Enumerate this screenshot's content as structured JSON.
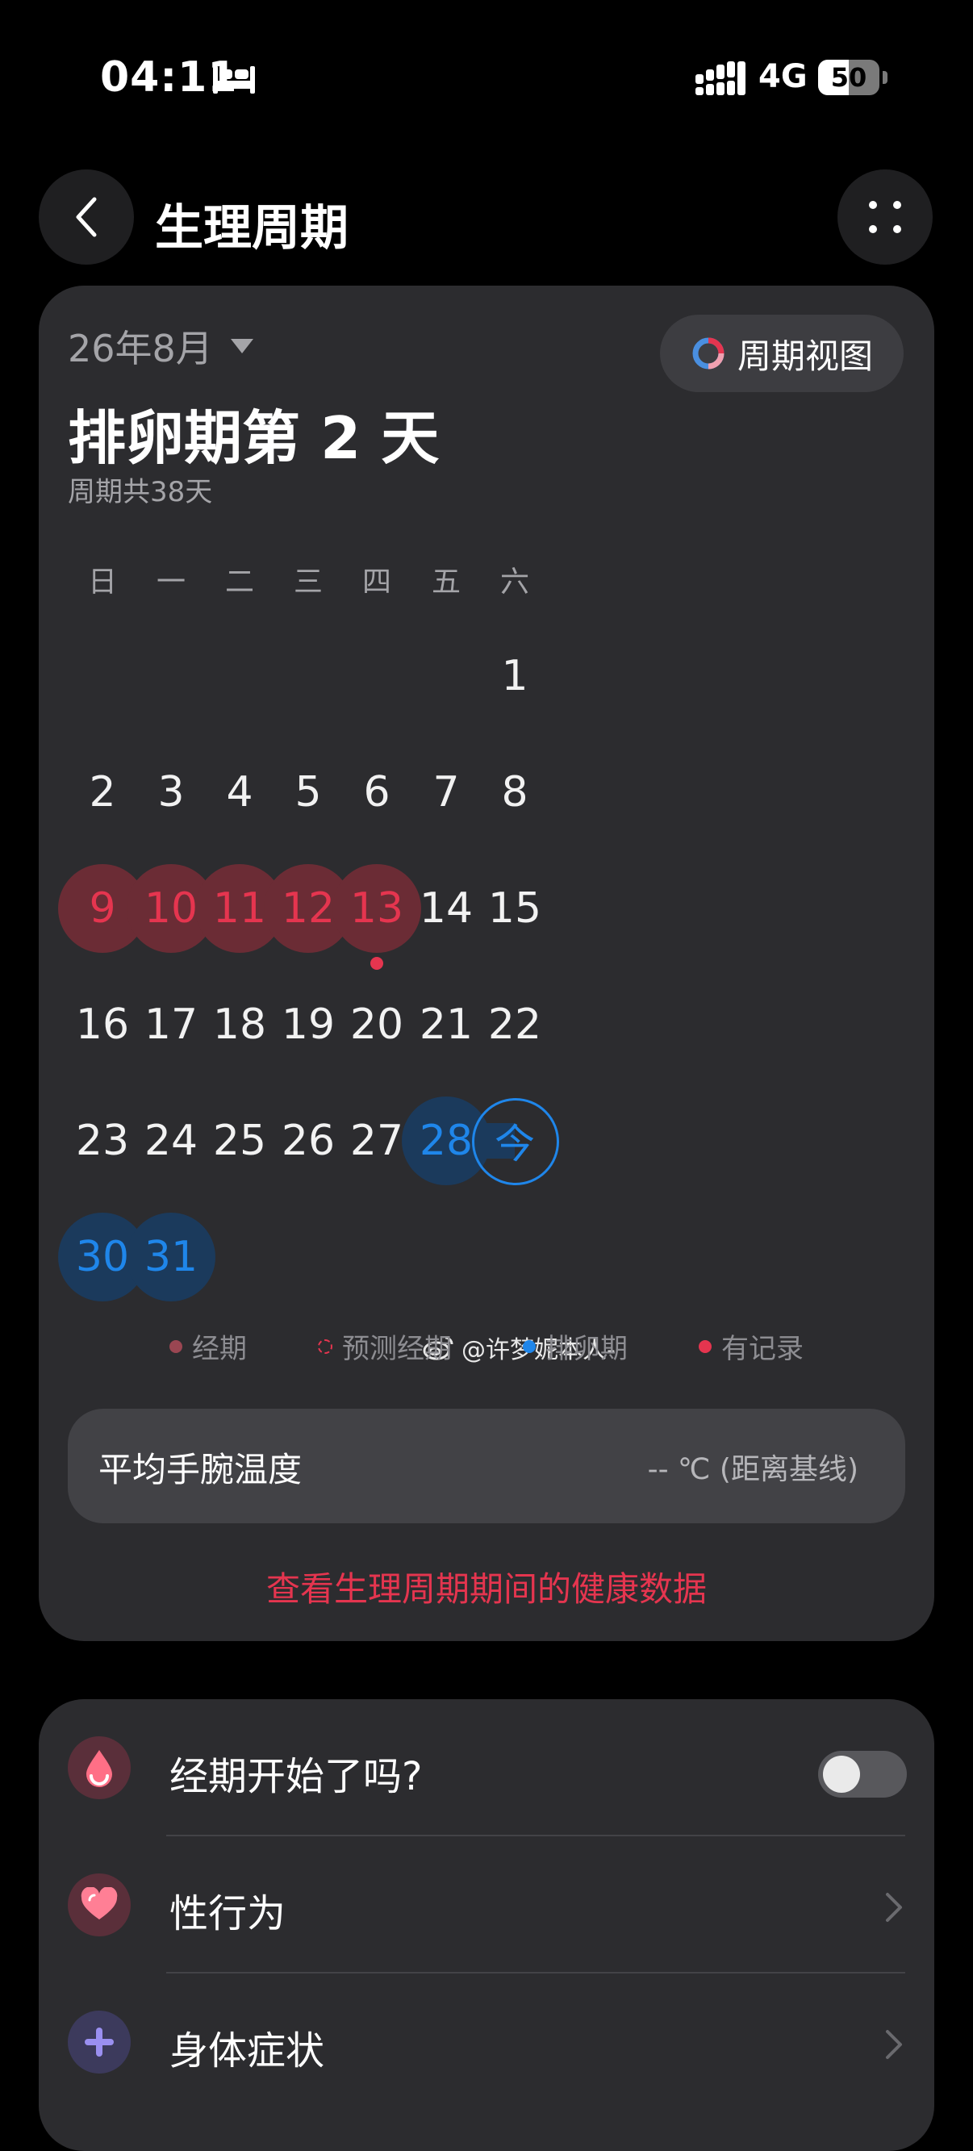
{
  "status_bar": {
    "time": "04:11",
    "network": "4G",
    "battery": "50",
    "battery_level_percent": 50
  },
  "header": {
    "title": "生理周期"
  },
  "calendar_card": {
    "month": "26年8月",
    "cycle_view_label": "周期视图",
    "phase_title": "排卵期第 2 天",
    "cycle_length": "周期共38天",
    "weekdays": [
      "日",
      "一",
      "二",
      "三",
      "四",
      "五",
      "六"
    ],
    "first_weekday_index": 6,
    "days_in_month": 31,
    "period_days": [
      9,
      10,
      11,
      12,
      13
    ],
    "ovulation_days": [
      28,
      29,
      30,
      31
    ],
    "today": 29,
    "today_label": "今",
    "recorded_days": [
      13
    ],
    "legend": {
      "period": "经期",
      "predicted": "预测经期",
      "ovulation": "排卵期",
      "recorded": "有记录"
    },
    "temperature_label": "平均手腕温度",
    "temperature_value": "-- ℃ (距离基线)",
    "health_link": "查看生理周期期间的健康数据",
    "watermark": "@许梦妮本人-"
  },
  "colors": {
    "period_text": "#e5354f",
    "period_bg": "#6b2c35",
    "ovulation_text": "#1f86ea",
    "ovulation_bg": "#1b3a5c",
    "card_bg": "#2c2c2f"
  },
  "record_card": {
    "rows": [
      {
        "label": "经期开始了吗?",
        "icon": "blood-drop-icon",
        "control": "toggle",
        "toggle_on": false
      },
      {
        "label": "性行为",
        "icon": "heart-icon",
        "control": "chevron"
      },
      {
        "label": "身体症状",
        "icon": "plus-icon",
        "control": "chevron"
      }
    ]
  }
}
